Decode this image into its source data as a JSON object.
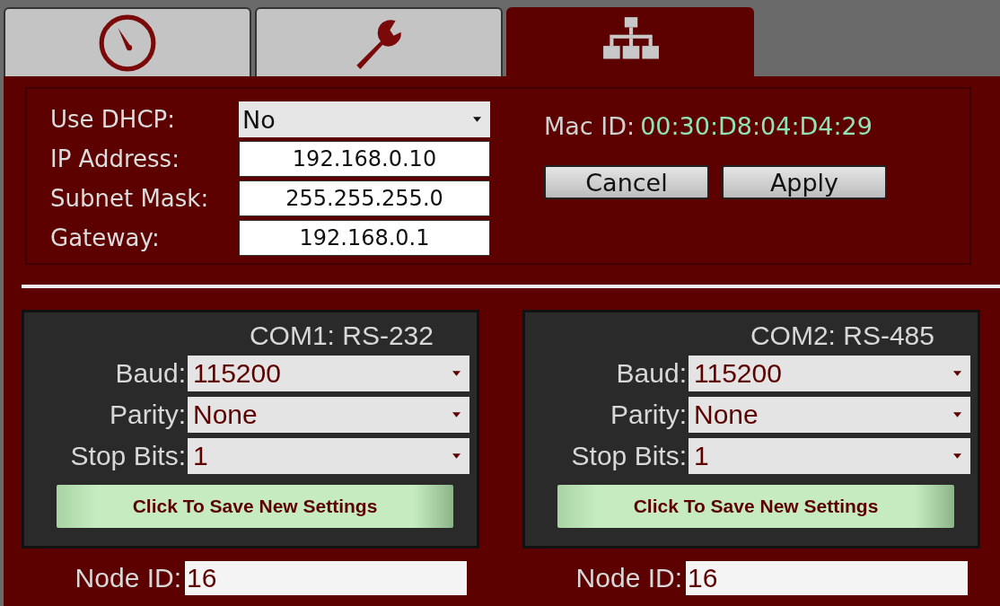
{
  "tabs": [
    {
      "kind": "gauge",
      "selected": false
    },
    {
      "kind": "wrench",
      "selected": false
    },
    {
      "kind": "network",
      "selected": true
    }
  ],
  "network": {
    "fields": [
      {
        "label": "Use DHCP:",
        "value": "No",
        "kind": "dropdown"
      },
      {
        "label": "IP Address:",
        "value": "192.168.0.10",
        "kind": "text"
      },
      {
        "label": "Subnet Mask:",
        "value": "255.255.255.0",
        "kind": "text"
      },
      {
        "label": "Gateway:",
        "value": "192.168.0.1",
        "kind": "text"
      }
    ],
    "mac_label": "Mac ID:",
    "mac_value": "00:30:D8:04:D4:29",
    "buttons": [
      "Cancel",
      "Apply"
    ]
  },
  "ports": [
    {
      "title": "COM1: RS-232",
      "settings": [
        {
          "label": "Baud:",
          "value": "115200"
        },
        {
          "label": "Parity:",
          "value": "None"
        },
        {
          "label": "Stop Bits:",
          "value": "1"
        }
      ],
      "save_button": "Click To Save New Settings",
      "node_label": "Node ID:",
      "node_value": "16"
    },
    {
      "title": "COM2: RS-485",
      "settings": [
        {
          "label": "Baud:",
          "value": "115200"
        },
        {
          "label": "Parity:",
          "value": "None"
        },
        {
          "label": "Stop Bits:",
          "value": "1"
        }
      ],
      "save_button": "Click To Save New Settings",
      "node_label": "Node ID:",
      "node_value": "16"
    }
  ]
}
